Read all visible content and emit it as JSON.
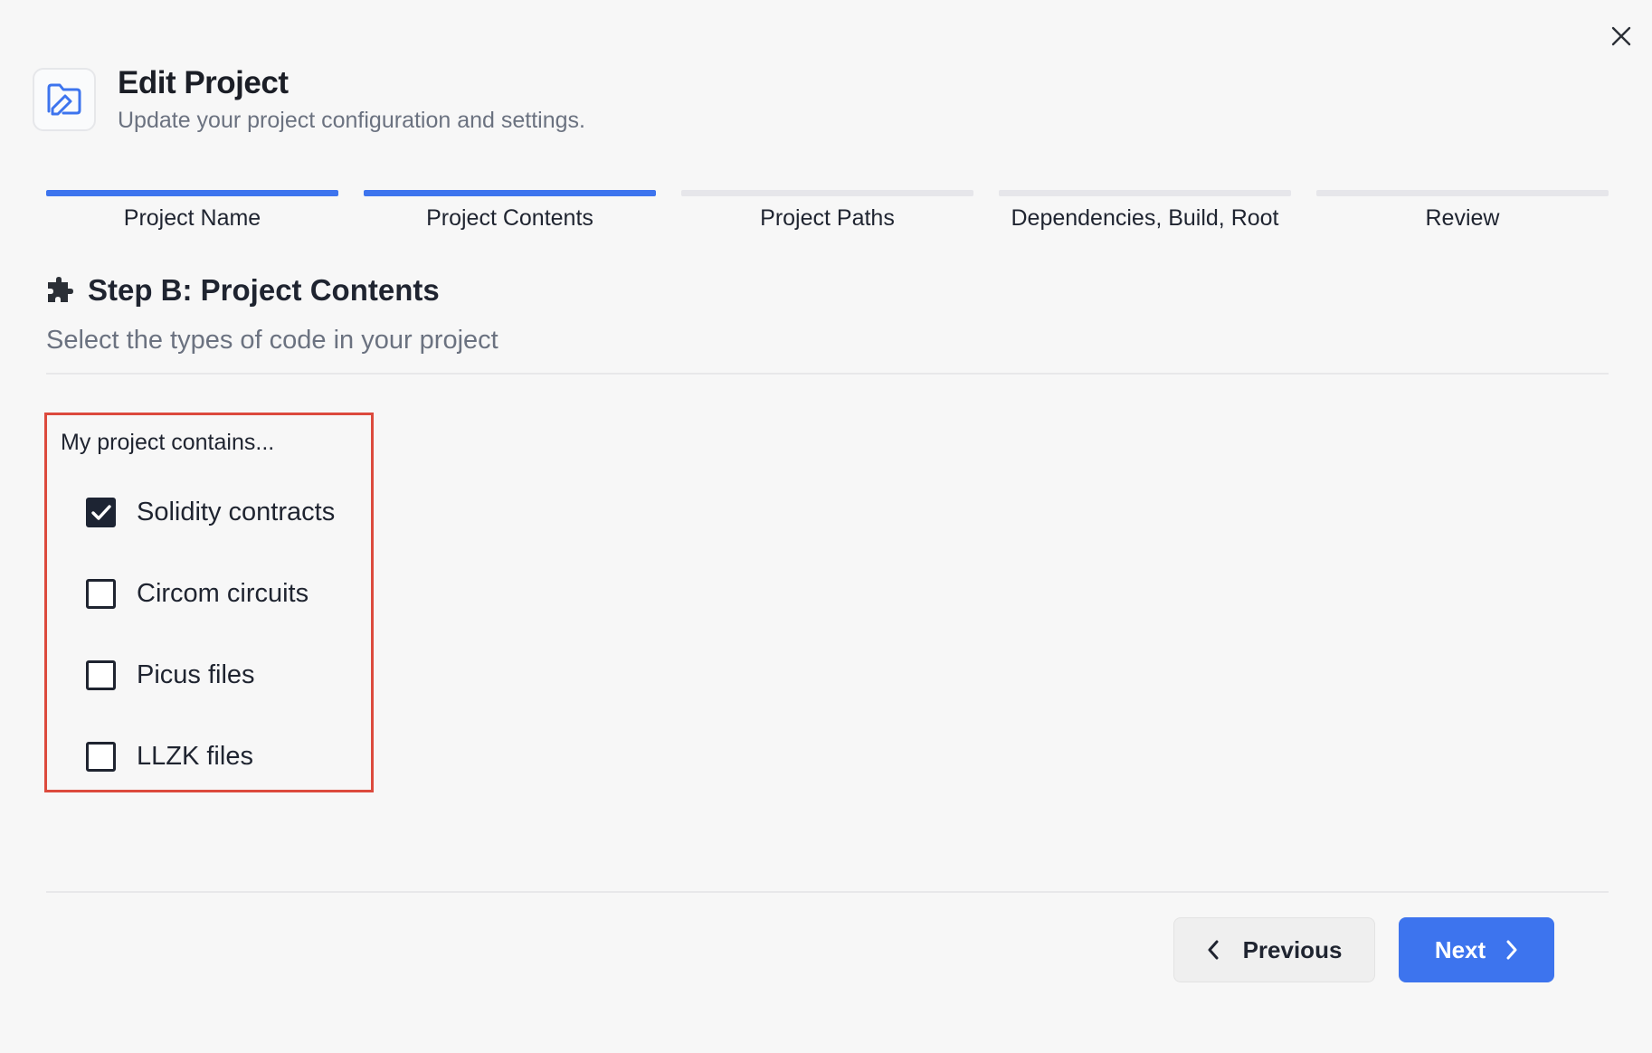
{
  "dialog": {
    "title": "Edit Project",
    "subtitle": "Update your project configuration and settings.",
    "close_icon": "close-icon",
    "header_icon": "folder-edit-icon"
  },
  "stepper": {
    "steps": [
      {
        "label": "Project Name",
        "completed": true
      },
      {
        "label": "Project Contents",
        "completed": true
      },
      {
        "label": "Project Paths",
        "completed": false
      },
      {
        "label": "Dependencies, Build, Root",
        "completed": false
      },
      {
        "label": "Review",
        "completed": false
      }
    ]
  },
  "section": {
    "title": "Step B: Project Contents",
    "subtitle": "Select the types of code in your project",
    "icon": "puzzle-icon"
  },
  "contents": {
    "label": "My project contains...",
    "options": [
      {
        "label": "Solidity contracts",
        "checked": true
      },
      {
        "label": "Circom circuits",
        "checked": false
      },
      {
        "label": "Picus files",
        "checked": false
      },
      {
        "label": "LLZK files",
        "checked": false
      }
    ]
  },
  "footer": {
    "previous_label": "Previous",
    "next_label": "Next"
  },
  "colors": {
    "accent": "#3d74ee",
    "highlight_border": "#dc4a3d",
    "checkbox_checked": "#1d2433"
  }
}
